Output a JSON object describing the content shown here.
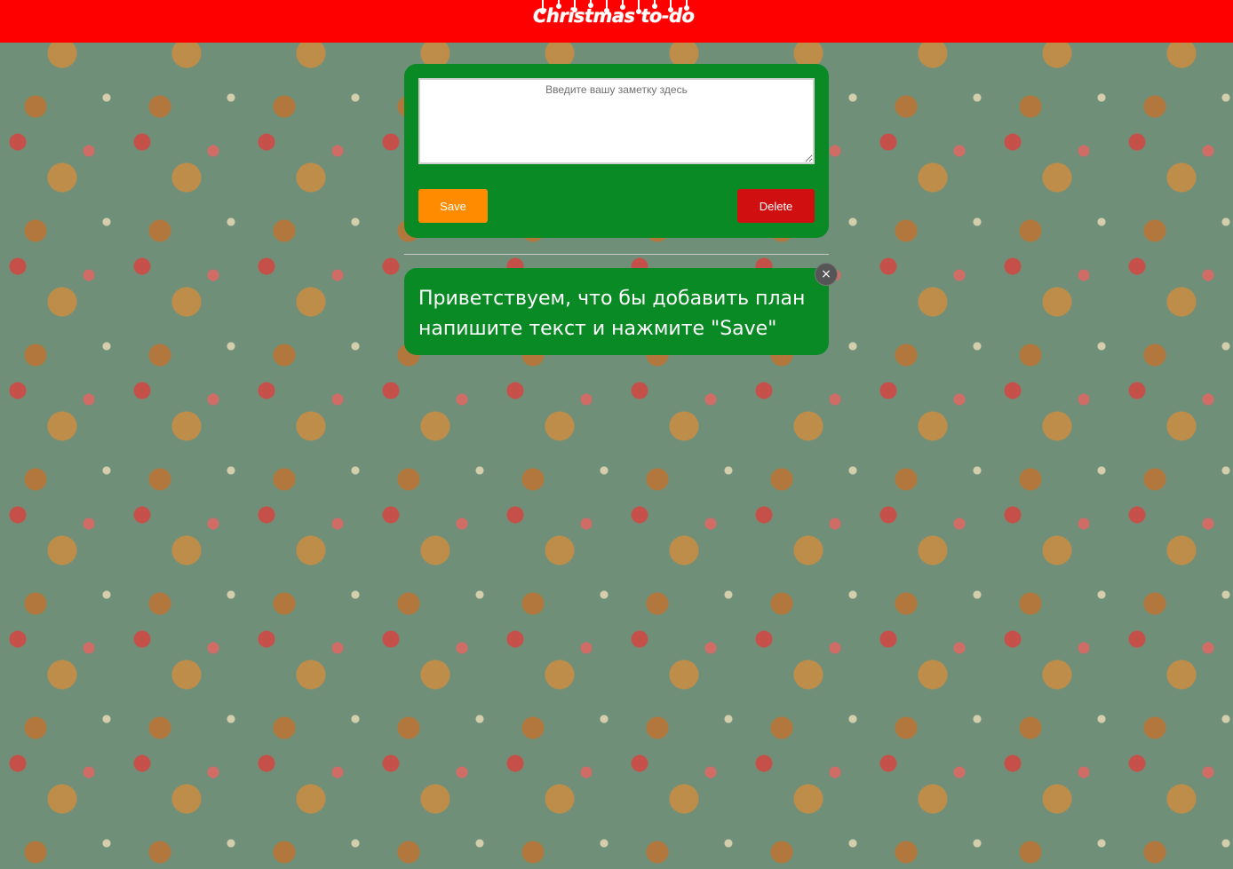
{
  "header": {
    "title": "Christmas to-do"
  },
  "editor": {
    "placeholder": "Введите вашу заметку здесь",
    "value": "",
    "save_label": "Save",
    "delete_label": "Delete"
  },
  "notes": [
    {
      "text": "Приветствуем, что бы добавить план напишите текст и нажмите \"Save\"",
      "close_label": "×"
    }
  ],
  "colors": {
    "header_bg": "#ff0000",
    "card_bg": "#0a8a25",
    "save_bg": "#ff8c00",
    "delete_bg": "#d01010",
    "close_bg": "#555555"
  }
}
